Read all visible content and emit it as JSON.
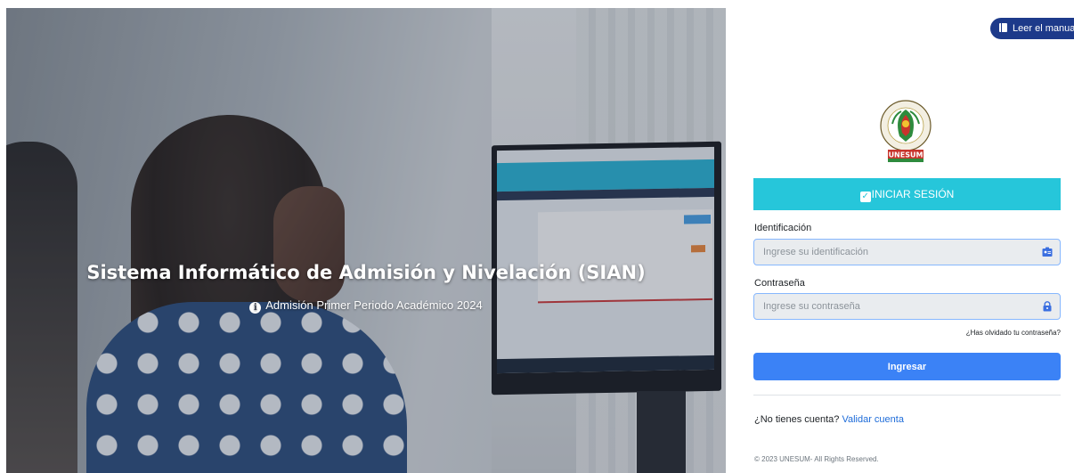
{
  "hero": {
    "title": "Sistema Informático de Admisión y Nivelación (SIAN)",
    "subtitle": "Admisión Primer Periodo Académico 2024",
    "subtitle_icon": "info-circle-icon"
  },
  "manual": {
    "label": "Leer el manual",
    "icon": "book-icon",
    "color": "#1d3a8a"
  },
  "logo": {
    "caption": "UNESUM",
    "alt": "Universidad Estatal del Sur de Manabí"
  },
  "login": {
    "header": "INICIAR SESIÓN",
    "header_color": "#26c6da",
    "id_label": "Identificación",
    "id_placeholder": "Ingrese su identificación",
    "id_value": "",
    "id_icon": "id-card-icon",
    "password_label": "Contraseña",
    "password_placeholder": "Ingrese su contraseña",
    "password_value": "",
    "password_icon": "lock-icon",
    "forgot": "¿Has olvidado tu contraseña?",
    "submit": "Ingresar",
    "submit_color": "#3b82f6"
  },
  "footer": {
    "no_account": "¿No tienes cuenta?",
    "validate": "Validar cuenta",
    "copyright": "© 2023 UNESUM- All Rights Reserved."
  }
}
